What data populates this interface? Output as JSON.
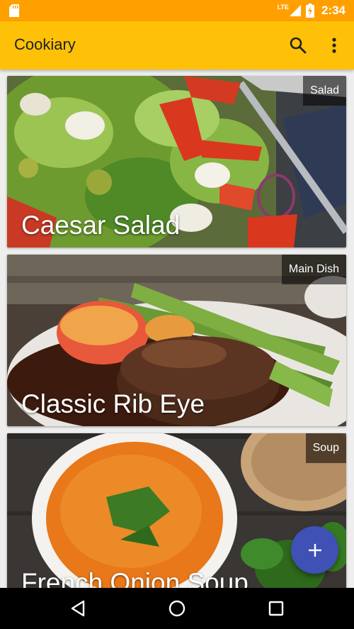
{
  "status_bar": {
    "time": "2:34",
    "network": "LTE",
    "icons": [
      "sd-card-icon",
      "signal-icon",
      "battery-charging-icon"
    ]
  },
  "app_bar": {
    "title": "Cookiary",
    "actions": [
      "search-icon",
      "more-vert-icon"
    ]
  },
  "recipes": [
    {
      "title": "Caesar Salad",
      "category": "Salad"
    },
    {
      "title": "Classic Rib Eye",
      "category": "Main Dish"
    },
    {
      "title": "French Onion Soup",
      "category": "Soup"
    }
  ],
  "fab": {
    "icon": "add-icon"
  },
  "nav_bar": {
    "buttons": [
      "back-icon",
      "home-icon",
      "recents-icon"
    ]
  },
  "colors": {
    "status_bar": "#ffa000",
    "app_bar": "#ffc107",
    "fab": "#3f51b5",
    "background": "#eeeeee"
  }
}
